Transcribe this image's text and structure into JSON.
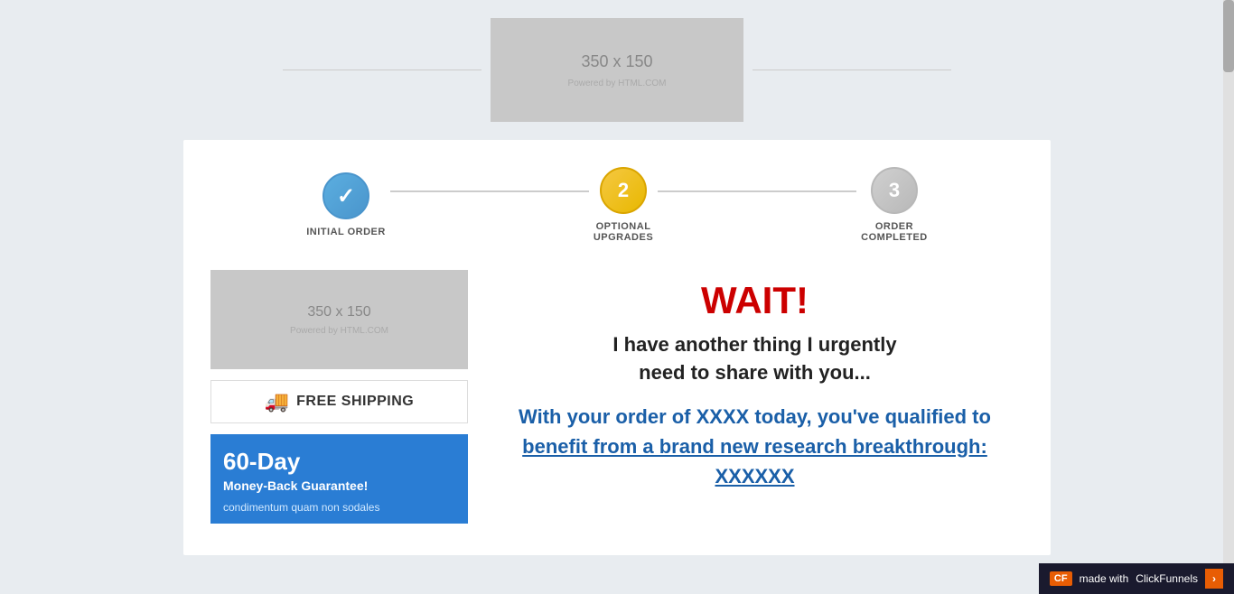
{
  "header": {
    "logo_placeholder": "350 x 150",
    "logo_powered": "Powered by HTML.COM"
  },
  "steps": [
    {
      "number": "✓",
      "label": "INITIAL ORDER",
      "state": "completed"
    },
    {
      "number": "2",
      "label": "OPTIONAL\nUPGRADES",
      "state": "active"
    },
    {
      "number": "3",
      "label": "ORDER\nCOMPLETED",
      "state": "inactive"
    }
  ],
  "sidebar": {
    "image_placeholder": "350 x 150",
    "image_powered": "Powered by HTML.COM",
    "free_shipping_label": "FREE SHIPPING",
    "money_back": {
      "title": "60-Day",
      "subtitle": "Money-Back Guarantee!",
      "description": "condimentum quam non sodales"
    }
  },
  "main_content": {
    "wait_title": "WAIT!",
    "urgent_line1": "I have another thing I urgently",
    "urgent_line2": "need to share with you...",
    "order_text_before": "With your order of XXXX today, you've qualified to ",
    "order_link_text": "benefit from a brand new research breakthrough: XXXXXX",
    "order_text_after": ""
  },
  "clickfunnels": {
    "label": "made with",
    "brand": "ClickFunnels",
    "arrow": "›"
  }
}
